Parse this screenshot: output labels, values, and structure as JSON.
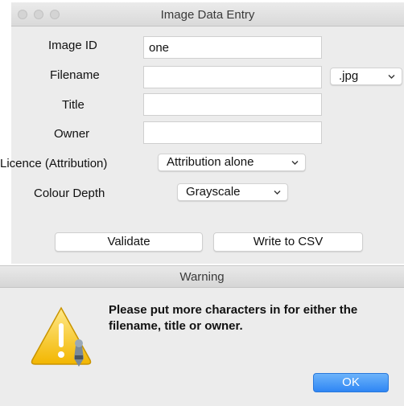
{
  "window": {
    "title": "Image Data Entry",
    "traffic_lights": [
      "close-button",
      "minimize-button",
      "zoom-button"
    ]
  },
  "form": {
    "image_id": {
      "label": "Image ID",
      "value": "one"
    },
    "filename": {
      "label": "Filename",
      "value": "",
      "extension": ".jpg"
    },
    "title": {
      "label": "Title",
      "value": ""
    },
    "owner": {
      "label": "Owner",
      "value": ""
    },
    "licence": {
      "label": "Licence (Attribution)",
      "value": "Attribution alone"
    },
    "colour_depth": {
      "label": "Colour Depth",
      "value": "Grayscale"
    }
  },
  "buttons": {
    "validate": "Validate",
    "write_csv": "Write to CSV"
  },
  "warning": {
    "title": "Warning",
    "message": "Please put more characters in for either the filename, title or owner.",
    "ok_label": "OK",
    "icon": "caution-triangle-icon"
  },
  "colors": {
    "accent_button": "#3b8ff5",
    "window_background": "#ececec",
    "warning_icon": "#f5c400"
  }
}
